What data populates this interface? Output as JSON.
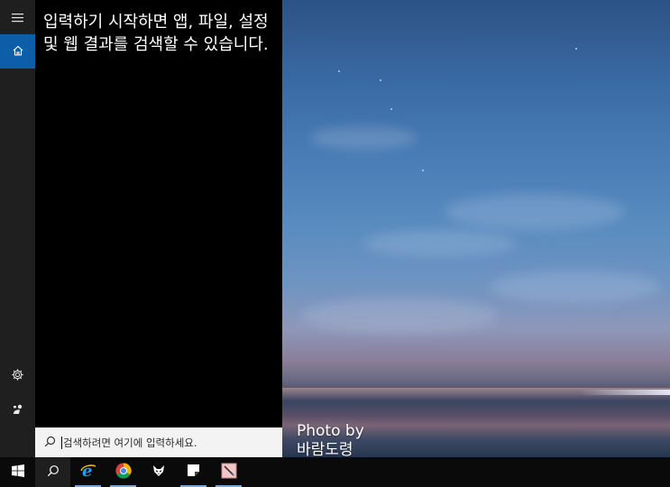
{
  "start_panel": {
    "hint_text": "입력하기 시작하면 앱, 파일, 설정 및 웹 결과를 검색할 수 있습니다."
  },
  "rail": {
    "items": [
      {
        "icon": "hamburger-menu-icon"
      },
      {
        "icon": "home-icon",
        "active": true
      },
      {
        "icon": "gear-icon"
      },
      {
        "icon": "feedback-icon"
      }
    ]
  },
  "search": {
    "placeholder": "검색하려면 여기에 입력하세요."
  },
  "wallpaper": {
    "credit_line1": "Photo by",
    "credit_line2": "바람도령"
  },
  "taskbar": {
    "items": [
      {
        "icon": "windows-start-icon"
      },
      {
        "icon": "search-icon",
        "active": true
      },
      {
        "icon": "internet-explorer-icon",
        "running": true
      },
      {
        "icon": "chrome-icon",
        "running": true
      },
      {
        "icon": "fox-app-icon"
      },
      {
        "icon": "sticky-notes-icon",
        "running": true
      },
      {
        "icon": "paint-app-icon",
        "running": true
      }
    ]
  },
  "colors": {
    "accent": "#0c5ea8",
    "rail_bg": "#1f1f1f",
    "panel_bg": "#000000",
    "taskbar_bg": "#0a0a0a",
    "searchbox_bg": "#f3f3f3"
  }
}
